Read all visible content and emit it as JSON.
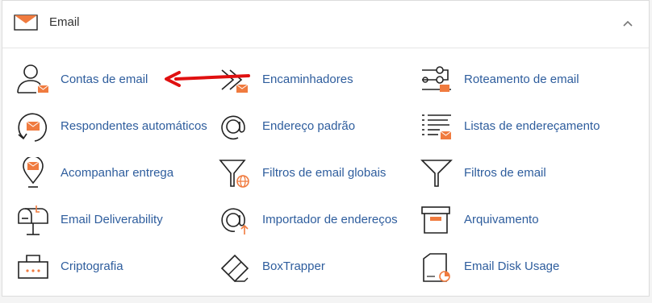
{
  "section": {
    "title": "Email",
    "icon": "envelope-icon",
    "collapse_icon": "chevron-up-icon"
  },
  "colors": {
    "accent": "#f07b3f",
    "link": "#2e5d9d",
    "arrow": "#e01010"
  },
  "items": [
    {
      "label": "Contas de email",
      "icon": "email-accounts-icon"
    },
    {
      "label": "Encaminhadores",
      "icon": "forwarders-icon"
    },
    {
      "label": "Roteamento de email",
      "icon": "email-routing-icon"
    },
    {
      "label": "Respondentes automáticos",
      "icon": "autoresponder-icon"
    },
    {
      "label": "Endereço padrão",
      "icon": "default-address-icon"
    },
    {
      "label": "Listas de endereçamento",
      "icon": "mailing-lists-icon"
    },
    {
      "label": "Acompanhar entrega",
      "icon": "track-delivery-icon"
    },
    {
      "label": "Filtros de email globais",
      "icon": "global-filters-icon"
    },
    {
      "label": "Filtros de email",
      "icon": "email-filters-icon"
    },
    {
      "label": "Email Deliverability",
      "icon": "mailbox-icon"
    },
    {
      "label": "Importador de endereços",
      "icon": "address-importer-icon"
    },
    {
      "label": "Arquivamento",
      "icon": "archive-icon"
    },
    {
      "label": "Criptografia",
      "icon": "encryption-icon"
    },
    {
      "label": "BoxTrapper",
      "icon": "boxtrapper-icon"
    },
    {
      "label": "Email Disk Usage",
      "icon": "disk-usage-icon"
    }
  ]
}
